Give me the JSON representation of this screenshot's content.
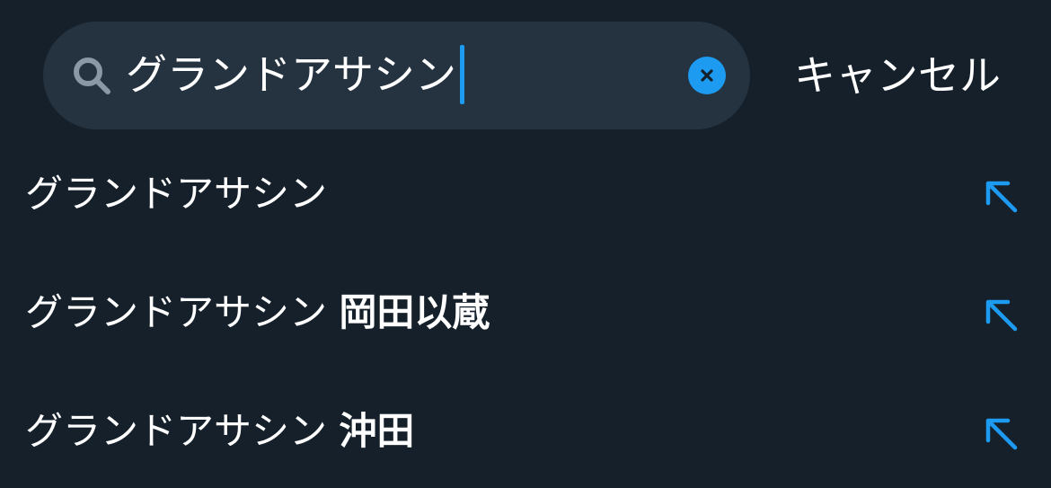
{
  "search": {
    "query": "グランドアサシン",
    "cancel_label": "キャンセル"
  },
  "suggestions": [
    {
      "base": "グランドアサシン",
      "extra": ""
    },
    {
      "base": "グランドアサシン",
      "extra": "岡田以蔵"
    },
    {
      "base": "グランドアサシン",
      "extra": "沖田"
    }
  ],
  "colors": {
    "background": "#15202b",
    "search_box": "#253341",
    "accent": "#1d9bf0",
    "text": "#ffffff",
    "icon_muted": "#8b98a5"
  },
  "icons": {
    "search": "search-icon",
    "clear": "clear-icon",
    "fill": "arrow-up-left-icon"
  }
}
